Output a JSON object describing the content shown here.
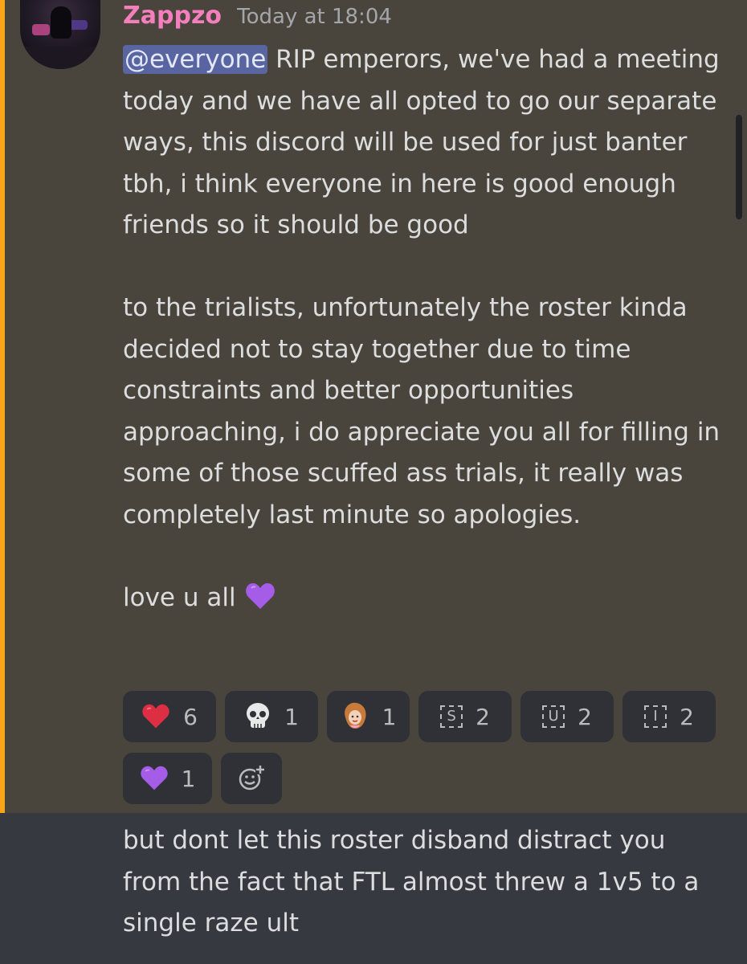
{
  "message": {
    "author": "Zappzo",
    "timestamp": "Today at 18:04",
    "mention": "@everyone",
    "paragraph1": " RIP emperors, we've had a meeting today and we have all opted to go our separate ways, this discord will be used for just banter tbh, i think everyone in here is good enough friends so it should be good",
    "paragraph2": "to the trialists, unfortunately the roster kinda decided not to stay together due to time constraints and better opportunities approaching, i do appreciate you all for filling in some of those scuffed ass trials, it really was completely last minute so apologies.",
    "paragraph3": "love u all"
  },
  "reactions": [
    {
      "icon": "heart-emoji",
      "count": "6"
    },
    {
      "icon": "skull-emoji",
      "count": "1"
    },
    {
      "icon": "custom-avatar-emoji",
      "count": "1"
    },
    {
      "icon": "letter-s-emoji",
      "glyph": "S",
      "count": "2"
    },
    {
      "icon": "letter-u-emoji",
      "glyph": "U",
      "count": "2"
    },
    {
      "icon": "letter-i-emoji",
      "glyph": "I",
      "count": "2"
    },
    {
      "icon": "purple-heart-emoji",
      "count": "1"
    },
    {
      "icon": "add-reaction-icon"
    }
  ],
  "next_message": {
    "text": "but dont let this roster disband distract you from the fact that FTL almost threw a 1v5 to a single raze ult"
  },
  "colors": {
    "mention_highlight": "#49443c",
    "mention_bar": "#faa61a",
    "username": "#f47fbc",
    "background": "#36393f"
  }
}
